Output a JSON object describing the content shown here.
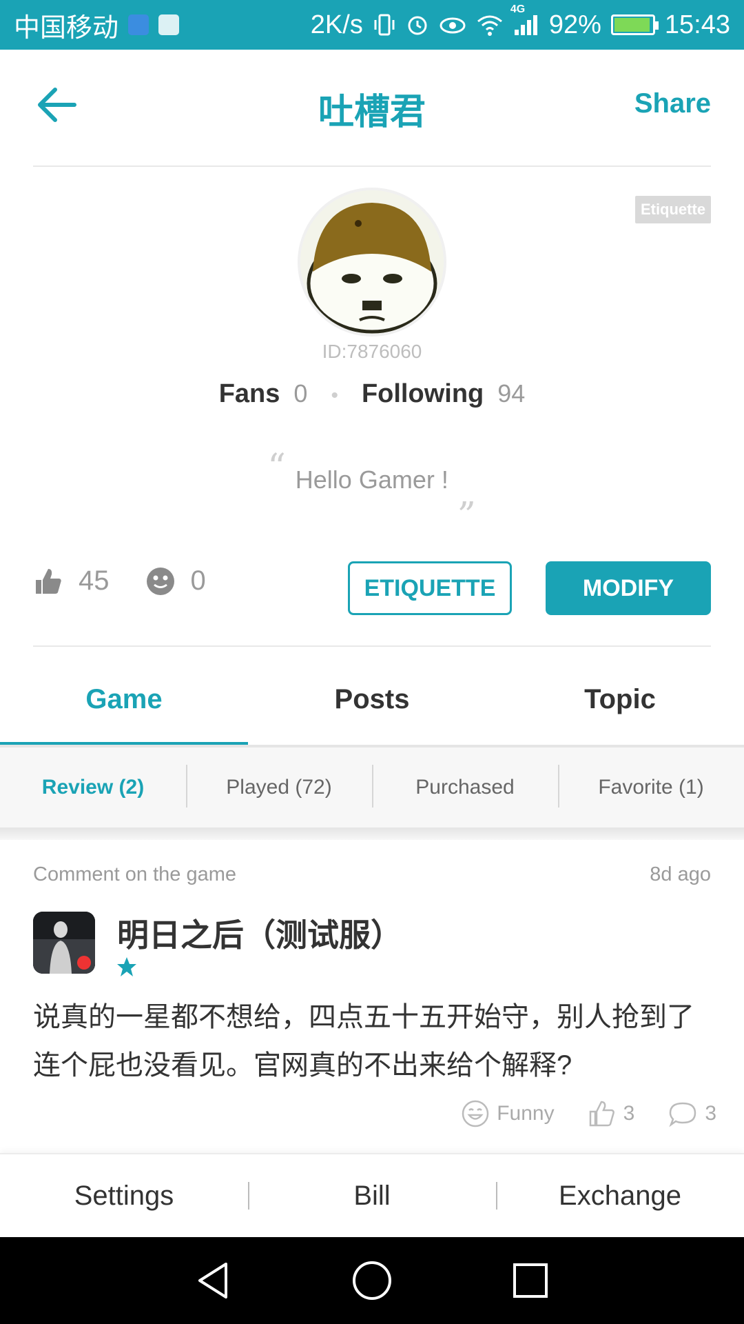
{
  "status_bar": {
    "carrier": "中国移动",
    "net_speed": "2K/s",
    "network_type": "4G",
    "battery": "92%",
    "time": "15:43"
  },
  "header": {
    "title": "吐槽君",
    "share_label": "Share"
  },
  "profile": {
    "tag_label": "Etiquette",
    "user_id": "ID:7876060",
    "fans_label": "Fans",
    "fans_count": "0",
    "following_label": "Following",
    "following_count": "94",
    "quote_open": "“",
    "quote_close": "„",
    "signature": "Hello Gamer !"
  },
  "stats": {
    "likes": "45",
    "emoji_count": "0"
  },
  "actions": {
    "etiquette_label": "ETIQUETTE",
    "modify_label": "MODIFY"
  },
  "tabs": [
    {
      "label": "Game",
      "active": true
    },
    {
      "label": "Posts",
      "active": false
    },
    {
      "label": "Topic",
      "active": false
    }
  ],
  "subtabs": [
    {
      "label": "Review (2)",
      "active": true
    },
    {
      "label": "Played (72)",
      "active": false
    },
    {
      "label": "Purchased",
      "active": false
    },
    {
      "label": "Favorite (1)",
      "active": false
    }
  ],
  "review": {
    "label": "Comment on the game",
    "time": "8d ago",
    "game_name": "明日之后（测试服）",
    "rating_stars": 1,
    "text": "说真的一星都不想给，四点五十五开始守，别人抢到了连个屁也没看见。官网真的不出来给个解释?",
    "funny_label": "Funny",
    "like_count": "3",
    "comment_count": "3"
  },
  "bottom_menu": {
    "settings": "Settings",
    "bill": "Bill",
    "exchange": "Exchange"
  },
  "colors": {
    "accent": "#1aa3b5",
    "text": "#333333",
    "muted": "#9a9a9a"
  }
}
